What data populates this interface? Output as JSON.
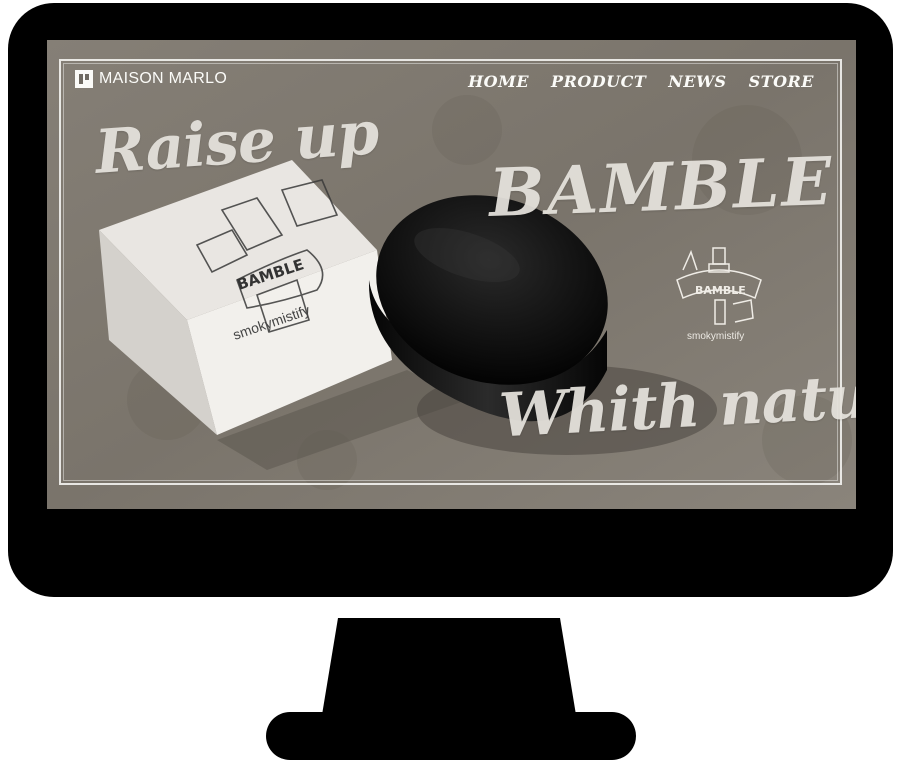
{
  "site": {
    "brand": "MAISON MARLO",
    "nav": [
      "HOME",
      "PRODUCT",
      "NEWS",
      "STORE"
    ]
  },
  "hero": {
    "headline_left": "Raise up",
    "headline_right": "BAMBLE",
    "headline_bottom": "Whith nature",
    "product_box_brand": "BAMBLE",
    "product_box_caption": "smokymistify",
    "emblem_label": "BAMBLE",
    "emblem_caption": "smokymistify"
  },
  "colors": {
    "monitor": "#000000",
    "text": "#fbfbf8",
    "background": "#7d7870"
  },
  "icons": {
    "logo": "maison-marlo-logo-icon",
    "emblem": "bamble-emblem-icon"
  }
}
